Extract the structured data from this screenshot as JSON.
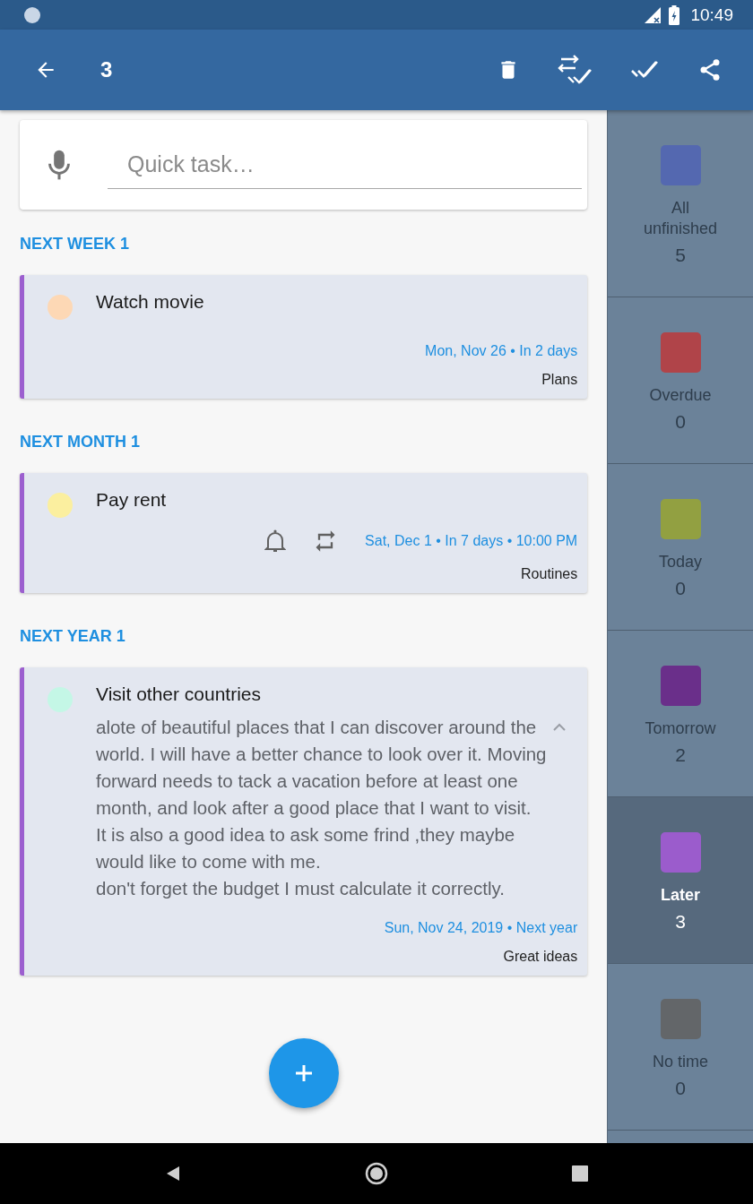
{
  "status_bar": {
    "time": "10:49"
  },
  "toolbar": {
    "title": "3"
  },
  "quick_task": {
    "placeholder": "Quick task…"
  },
  "groups": [
    {
      "heading": "NEXT WEEK 1",
      "tasks": [
        {
          "title": "Watch movie",
          "color": "#fdd8b5",
          "date": "Mon, Nov 26 • In 2 days",
          "category": "Plans",
          "reminder": false,
          "repeat": false
        }
      ]
    },
    {
      "heading": "NEXT MONTH 1",
      "tasks": [
        {
          "title": "Pay rent",
          "color": "#fbef9f",
          "date": "Sat, Dec 1 • In 7 days • 10:00 PM",
          "category": "Routines",
          "reminder": true,
          "repeat": true
        }
      ]
    },
    {
      "heading": "NEXT YEAR 1",
      "tasks": [
        {
          "title": "Visit other countries",
          "color": "#c4f7e6",
          "note": "alote of beautiful places that I can discover around the world. I will have a better chance to look over it. Moving forward needs to tack a vacation before at least one month, and look after a good place that I want to visit.\nIt is also a good idea to ask some frind ,they maybe would like to come with me.\ndon't forget the budget I must calculate it correctly.",
          "expanded": true,
          "date": "Sun, Nov 24, 2019 • Next year",
          "category": "Great ideas",
          "reminder": false,
          "repeat": false
        }
      ]
    }
  ],
  "sidebar": {
    "items": [
      {
        "label": "All unfinished",
        "count": "5",
        "color": "#5468b0",
        "selected": false
      },
      {
        "label": "Overdue",
        "count": "0",
        "color": "#b04449",
        "selected": false
      },
      {
        "label": "Today",
        "count": "0",
        "color": "#92a041",
        "selected": false
      },
      {
        "label": "Tomorrow",
        "count": "2",
        "color": "#6a2f8a",
        "selected": false
      },
      {
        "label": "Later",
        "count": "3",
        "color": "#9b5ccc",
        "selected": true
      },
      {
        "label": "No time",
        "count": "0",
        "color": "#636669",
        "selected": false
      }
    ]
  }
}
